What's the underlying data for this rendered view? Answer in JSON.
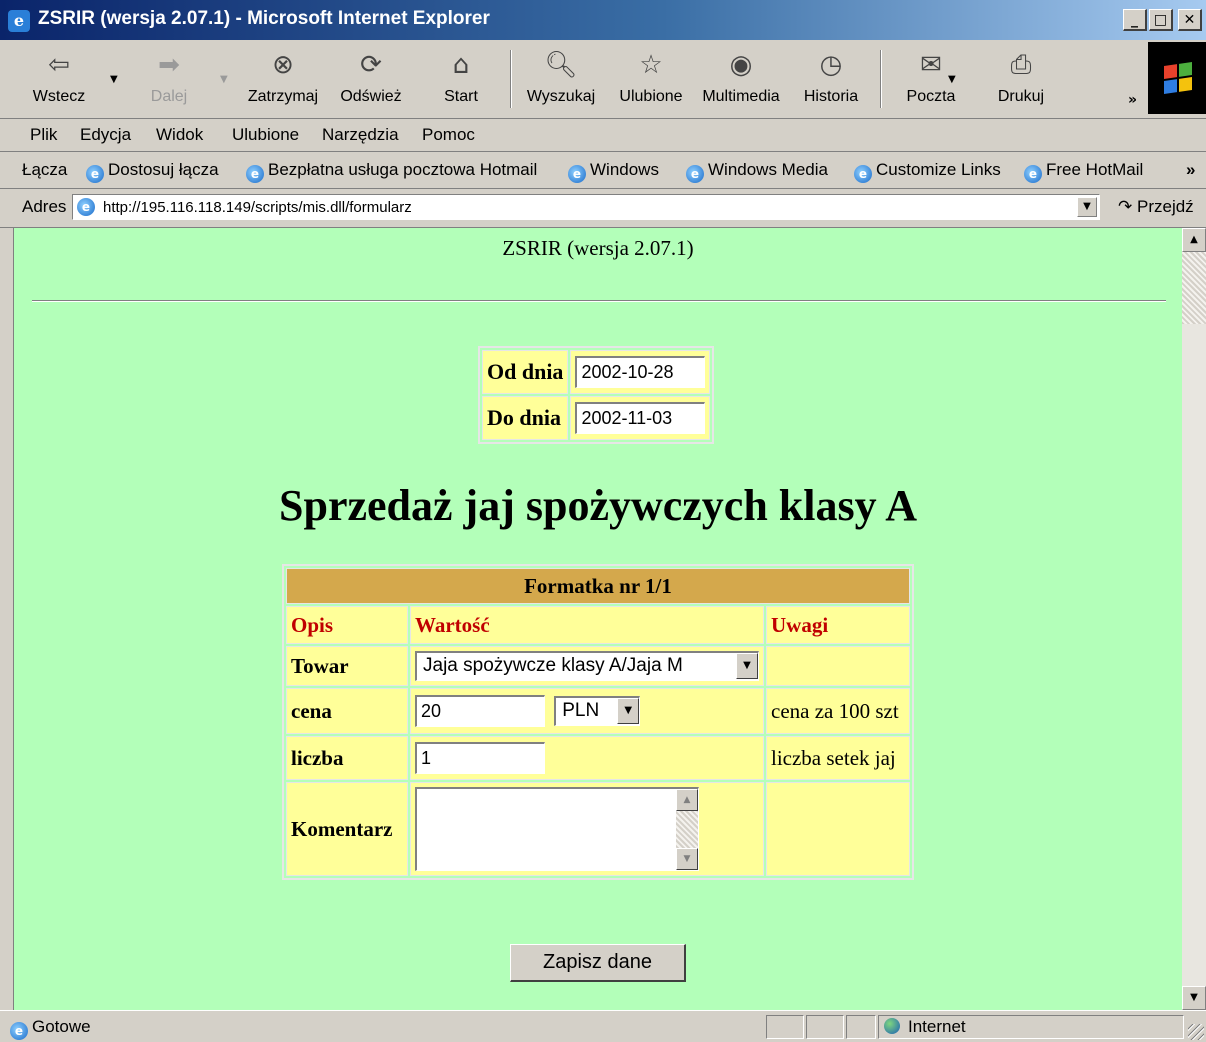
{
  "window": {
    "title": "ZSRIR (wersja 2.07.1) - Microsoft Internet Explorer",
    "controls": {
      "minimize": "_",
      "maximize": "□",
      "close": "✕"
    }
  },
  "toolbar": {
    "back": {
      "label": "Wstecz",
      "icon": "back-arrow-icon"
    },
    "forward": {
      "label": "Dalej",
      "icon": "forward-arrow-icon"
    },
    "stop": {
      "label": "Zatrzymaj",
      "icon": "stop-icon"
    },
    "refresh": {
      "label": "Odśwież",
      "icon": "refresh-icon"
    },
    "home": {
      "label": "Start",
      "icon": "home-icon"
    },
    "search": {
      "label": "Wyszukaj",
      "icon": "search-icon"
    },
    "favorites": {
      "label": "Ulubione",
      "icon": "favorites-icon"
    },
    "media": {
      "label": "Multimedia",
      "icon": "media-icon"
    },
    "history": {
      "label": "Historia",
      "icon": "history-icon"
    },
    "mail": {
      "label": "Poczta",
      "icon": "mail-icon"
    },
    "print": {
      "label": "Drukuj",
      "icon": "print-icon"
    }
  },
  "menubar": [
    "Plik",
    "Edycja",
    "Widok",
    "Ulubione",
    "Narzędzia",
    "Pomoc"
  ],
  "links": {
    "label": "Łącza",
    "items": [
      "Dostosuj łącza",
      "Bezpłatna usługa pocztowa Hotmail",
      "Windows",
      "Windows Media",
      "Customize Links",
      "Free HotMail"
    ]
  },
  "address": {
    "label": "Adres",
    "url": "http://195.116.118.149/scripts/mis.dll/formularz",
    "go": "Przejdź"
  },
  "page": {
    "heading": "ZSRIR (wersja 2.07.1)",
    "dates": {
      "from_label": "Od dnia",
      "from_value": "2002-10-28",
      "to_label": "Do dnia",
      "to_value": "2002-11-03"
    },
    "title": "Sprzedaż jaj spożywczych klasy A",
    "form": {
      "header": "Formatka nr 1/1",
      "columns": [
        "Opis",
        "Wartość",
        "Uwagi"
      ],
      "rows": {
        "towar": {
          "label": "Towar",
          "value": "Jaja spożywcze klasy A/Jaja M",
          "note": ""
        },
        "cena": {
          "label": "cena",
          "value": "20",
          "currency": "PLN",
          "note": "cena za 100 szt"
        },
        "liczba": {
          "label": "liczba",
          "value": "1",
          "note": "liczba setek jaj"
        },
        "komentarz": {
          "label": "Komentarz",
          "value": "",
          "note": ""
        }
      }
    },
    "submit": "Zapisz dane"
  },
  "status": {
    "text": "Gotowe",
    "zone": "Internet"
  },
  "colors": {
    "page_bg": "#b3ffb9",
    "cell_bg": "#ffff99",
    "header_bg": "#d4a84c",
    "column_header_text": "#c00000",
    "titlebar": "#0a246a"
  }
}
